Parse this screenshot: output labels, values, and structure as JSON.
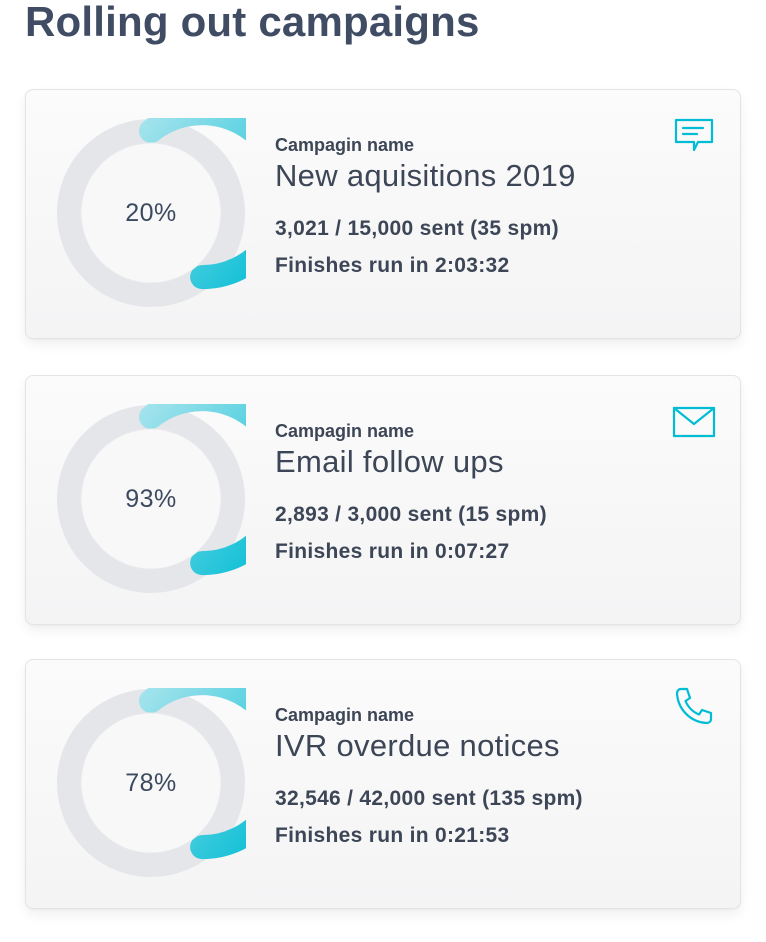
{
  "page": {
    "title": "Rolling out campaigns"
  },
  "colors": {
    "accent": "#00bcd4",
    "accent_light": "#8fdfe8",
    "track": "#e4e6ea",
    "text": "#3d4657"
  },
  "campaigns": [
    {
      "icon": "chat-message-icon",
      "percent_label": "20%",
      "progress": 0.2,
      "name_label": "Campagin name",
      "name": "New aquisitions 2019",
      "sent": "3,021 / 15,000 sent (35 spm)",
      "eta": "Finishes run in 2:03:32"
    },
    {
      "icon": "email-icon",
      "percent_label": "93%",
      "progress": 0.93,
      "name_label": "Campagin name",
      "name": "Email follow ups",
      "sent": "2,893 / 3,000 sent (15 spm)",
      "eta": "Finishes run in 0:07:27"
    },
    {
      "icon": "phone-icon",
      "percent_label": "78%",
      "progress": 0.78,
      "name_label": "Campagin name",
      "name": "IVR overdue notices",
      "sent": "32,546 / 42,000 sent (135 spm)",
      "eta": "Finishes run in 0:21:53"
    }
  ]
}
